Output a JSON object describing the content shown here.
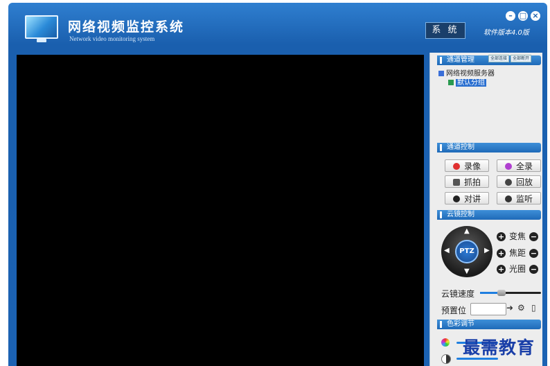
{
  "window": {
    "title": "网络视频监控系统",
    "subtitle": "Network video monitoring system",
    "system_button": "系 统",
    "version": "软件版本4.0版",
    "minimize": "–",
    "maximize": "□",
    "close": "×"
  },
  "channel_mgmt": {
    "title": "通道管理",
    "connect_all": "全部连接",
    "disconnect_all": "全部断开",
    "tree": {
      "root": "网络视频服务器",
      "child": "默认分组"
    }
  },
  "channel_ctrl": {
    "title": "通道控制",
    "record": "录像",
    "fullscreen": "全录",
    "capture": "抓拍",
    "playback": "回放",
    "intercom": "对讲",
    "monitor": "监听"
  },
  "ptz_ctrl": {
    "title": "云镜控制",
    "ptz_label": "PTZ",
    "zoom": "变焦",
    "focus": "焦距",
    "iris": "光圈",
    "speed_label": "云镜速度",
    "speed_value": 0.35,
    "preset_label": "预置位",
    "preset_value": ""
  },
  "color_adjust": {
    "title": "色彩调节"
  },
  "watermark": "最需教育",
  "colors": {
    "title_bar": "#1a5fae",
    "section_header": "#1f6ab8",
    "video_bg": "#000000",
    "record_icon": "#e03030",
    "fullscreen_icon": "#b040d0"
  }
}
